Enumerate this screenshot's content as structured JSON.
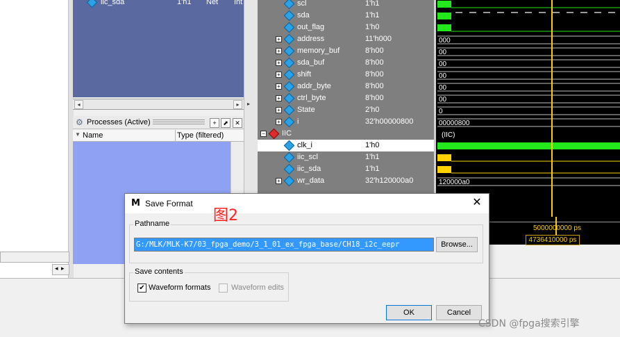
{
  "objects_panel": {
    "row": {
      "name": "iic_sda",
      "value": "1'h1",
      "kind": "Net",
      "type": "Int"
    }
  },
  "processes_panel": {
    "title": "Processes (Active)",
    "col_name": "Name",
    "col_type": "Type (filtered)",
    "btn_plus": "+",
    "btn_float": "⬈",
    "btn_close": "✕"
  },
  "waveform": {
    "rows": [
      {
        "name": "scl",
        "value": "1'h1",
        "expand": false
      },
      {
        "name": "sda",
        "value": "1'h1",
        "expand": false
      },
      {
        "name": "out_flag",
        "value": "1'h0",
        "expand": false
      },
      {
        "name": "address",
        "value": "11'h000",
        "expand": true,
        "wave": "000"
      },
      {
        "name": "memory_buf",
        "value": "8'h00",
        "expand": true,
        "wave": "00"
      },
      {
        "name": "sda_buf",
        "value": "8'h00",
        "expand": true,
        "wave": "00"
      },
      {
        "name": "shift",
        "value": "8'h00",
        "expand": true,
        "wave": "00"
      },
      {
        "name": "addr_byte",
        "value": "8'h00",
        "expand": true,
        "wave": "00"
      },
      {
        "name": "ctrl_byte",
        "value": "8'h00",
        "expand": true,
        "wave": "00"
      },
      {
        "name": "State",
        "value": "2'h0",
        "expand": true,
        "wave": "0"
      },
      {
        "name": "i",
        "value": "32'h00000800",
        "expand": true,
        "wave": "00000800"
      },
      {
        "name": "IIC",
        "value": "",
        "expand": true,
        "group": true,
        "wave": "(IIC)"
      },
      {
        "name": "clk_i",
        "value": "1'h0",
        "expand": false,
        "highlight": true
      },
      {
        "name": "iic_scl",
        "value": "1'h1",
        "expand": false
      },
      {
        "name": "iic_sda",
        "value": "1'h1",
        "expand": false
      },
      {
        "name": "wr_data",
        "value": "32'h120000a0",
        "expand": true,
        "wave": "120000a0"
      }
    ],
    "time_marker": "5000000000 ps",
    "cursor_time": "4736410000 ps",
    "colors": {
      "wave_green": "#22e81c",
      "wave_yellow": "#ffd200",
      "cursor": "#ffcc00",
      "bg": "#000000"
    }
  },
  "dialog": {
    "title": "Save Format",
    "icon": "M",
    "annotation": "图2",
    "pathname_label": "Pathname",
    "path_value": "G:/MLK/MLK-K7/03_fpga_demo/3_1_01_ex_fpga_base/CH18_i2c_eepr",
    "browse_label": "Browse...",
    "save_contents_label": "Save contents",
    "waveform_formats_label": "Waveform formats",
    "waveform_formats_checked": true,
    "waveform_edits_label": "Waveform edits",
    "waveform_edits_checked": false,
    "ok_label": "OK",
    "cancel_label": "Cancel",
    "close_glyph": "✕"
  },
  "watermark": "CSDN @fpga搜索引擎"
}
